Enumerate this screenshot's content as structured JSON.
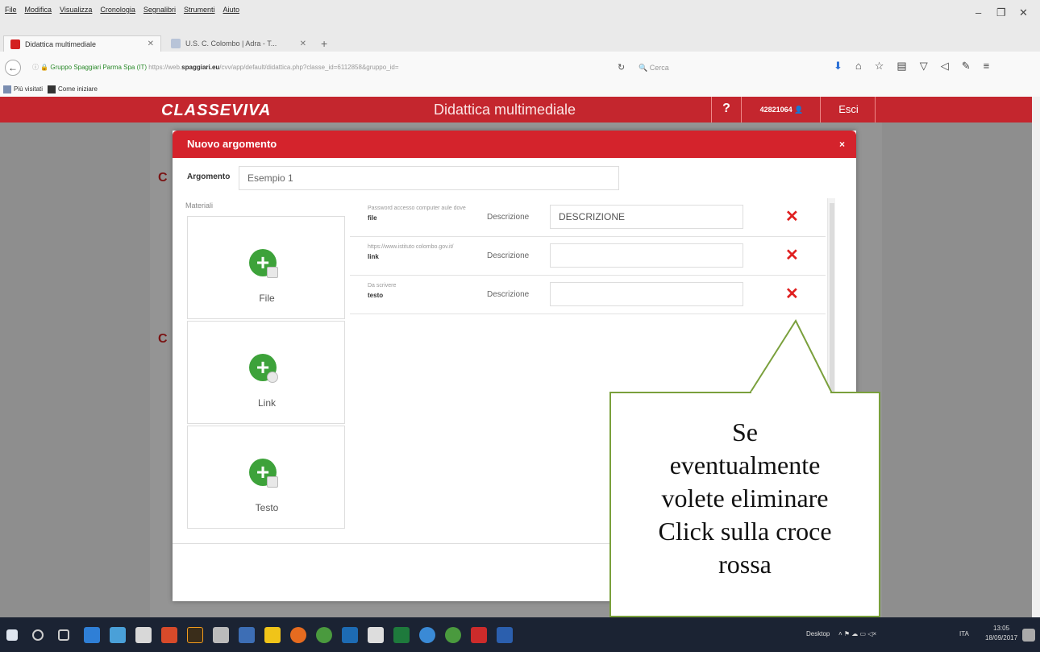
{
  "browser": {
    "menu": [
      "File",
      "Modifica",
      "Visualizza",
      "Cronologia",
      "Segnalibri",
      "Strumenti",
      "Aiuto"
    ],
    "window_controls": [
      "–",
      "❐",
      "✕"
    ],
    "tabs": [
      {
        "label": "Didattica multimediale",
        "active": true
      },
      {
        "label": "U.S. C. Colombo | Adra - T...",
        "active": false
      }
    ],
    "url_site": "Gruppo Spaggiari Parma Spa (IT)",
    "url_prefix": "https://web.",
    "url_domain": "spaggiari.eu",
    "url_rest": "/cvv/app/default/didattica.php?classe_id=6112858&gruppo_id=",
    "search_placeholder": "Cerca",
    "bookmarks": [
      "Più visitati",
      "Come iniziare"
    ]
  },
  "app": {
    "logo": "CLASSEVIVA",
    "page_title": "Didattica multimediale",
    "help": "?",
    "user": "42821064",
    "logout": "Esci"
  },
  "dialog": {
    "title": "Nuovo argomento",
    "close": "×",
    "argomento_label": "Argomento",
    "argomento_value": "Esempio 1",
    "materiali_label": "Materiali",
    "cards": [
      "File",
      "Link",
      "Testo"
    ],
    "rows": [
      {
        "info": "Password accesso computer aule dove",
        "type": "file",
        "desc_label": "Descrizione",
        "desc_value": "DESCRIZIONE"
      },
      {
        "info": "https://www.istituto colombo.gov.it/",
        "type": "link",
        "desc_label": "Descrizione",
        "desc_value": ""
      },
      {
        "info": "Da scrivere",
        "type": "testo",
        "desc_label": "Descrizione",
        "desc_value": ""
      }
    ]
  },
  "callout": {
    "lines": [
      "Se",
      "eventualmente",
      "volete eliminare",
      "Click sulla croce",
      "rossa"
    ]
  },
  "taskbar": {
    "desktop": "Desktop",
    "lang": "ITA",
    "time": "13:05",
    "date": "18/09/2017"
  },
  "colors": {
    "brand_red": "#c4262e",
    "add_green": "#3da23a",
    "delete_red": "#e02020",
    "callout_border": "#7aa03c"
  }
}
